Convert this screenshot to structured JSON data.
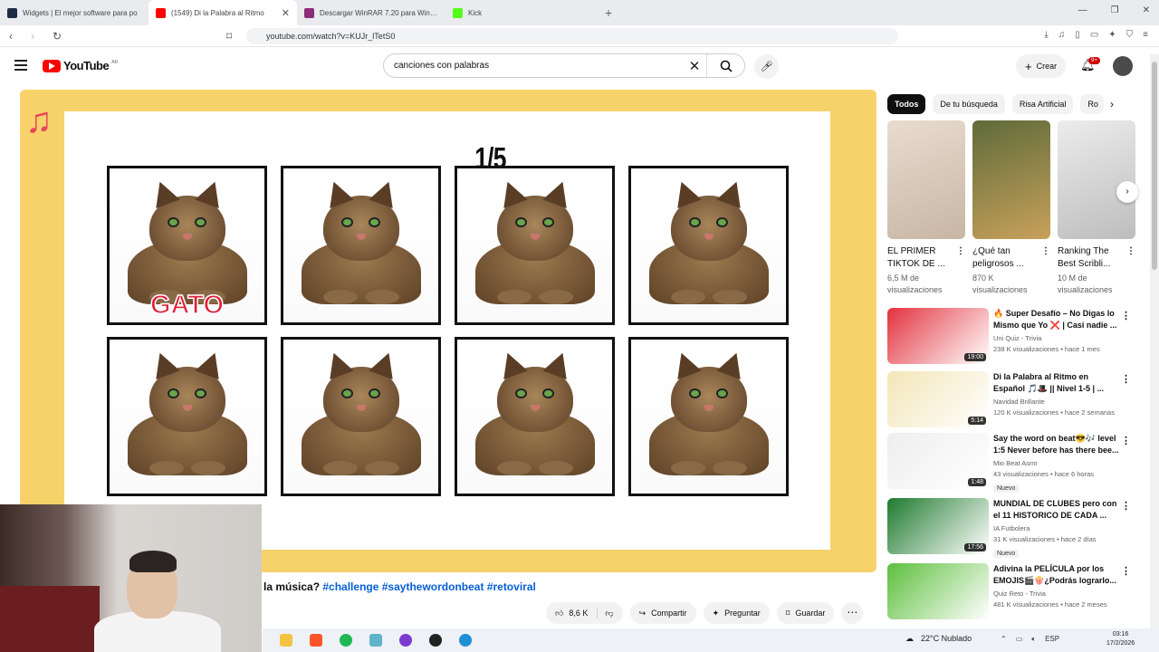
{
  "browser": {
    "tabs": [
      {
        "title": "Widgets | El mejor software para po",
        "color": "#1f2a44",
        "active": false
      },
      {
        "title": "(1549) Di la Palabra al Ritmo",
        "color": "#ff0000",
        "active": true
      },
      {
        "title": "Descargar WinRAR 7.20 para Window",
        "color": "#8b2d7a",
        "active": false
      },
      {
        "title": "Kick",
        "color": "#53fc18",
        "active": false
      }
    ],
    "new_tab": "+",
    "url": "youtube.com/watch?v=KUJr_lTetS0"
  },
  "youtube": {
    "logo_text": "YouTube",
    "region": "AR",
    "search_value": "canciones con palabras",
    "create_label": "Crear",
    "notif_count": "9+"
  },
  "video": {
    "counter": "1/5",
    "word": "GATO",
    "caption_prefix": "la música? ",
    "hashtags": [
      "#challenge",
      "#saythewordonbeat",
      "#retoviral"
    ],
    "likes": "8,6 K",
    "share_label": "Compartir",
    "ask_label": "Preguntar",
    "save_label": "Guardar"
  },
  "chips": [
    "Todos",
    "De tu búsqueda",
    "Risa Artificial",
    "Ro"
  ],
  "shorts": [
    {
      "title": "EL PRIMER TIKTOK DE ...",
      "views": "6,5 M de visualizaciones",
      "color1": "#e8dccf",
      "color2": "#c7b6a4"
    },
    {
      "title": "¿Qué tan peligrosos ...",
      "views": "870 K visualizaciones",
      "color1": "#5e6b3a",
      "color2": "#c8a15a"
    },
    {
      "title": "Ranking The Best Scribli...",
      "views": "10 M de visualizaciones",
      "color1": "#ececec",
      "color2": "#bdbdbd"
    }
  ],
  "recommendations": [
    {
      "title": "🔥 Super Desafío – No Digas lo Mismo que Yo ❌ | Casi nadie ...",
      "channel": "Uni Quiz - Trivia",
      "meta": "238 K visualizaciones • hace 1 mes",
      "duration": "19:00",
      "new": "",
      "color": "#e3323e"
    },
    {
      "title": "Di la Palabra al Ritmo en Español 🎵🎩 || Nivel 1-5 | ...",
      "channel": "Navidad Brillante",
      "meta": "120 K visualizaciones • hace 2 semanas",
      "duration": "5:14",
      "new": "",
      "color": "#f3e6b8"
    },
    {
      "title": "Say the word on beat😎🎶 level 1:5 Never before has there bee...",
      "channel": "Mio Beat Asmr",
      "meta": "43 visualizaciones • hace 6 horas",
      "duration": "1:48",
      "new": "Nuevo",
      "color": "#eeeeee"
    },
    {
      "title": "MUNDIAL DE CLUBES pero con el 11 HISTORICO DE CADA ...",
      "channel": "IA Futbolera",
      "meta": "31 K visualizaciones • hace 2 días",
      "duration": "17:56",
      "new": "Nuevo",
      "color": "#1f7a2e"
    },
    {
      "title": "Adivina la PELÍCULA por los EMOJIS🎬🍿¿Podrás lograrlo...",
      "channel": "Quiz Reto - Trivia",
      "meta": "481 K visualizaciones • hace 2 meses",
      "duration": "",
      "new": "",
      "color": "#5cbf3c"
    }
  ],
  "taskbar": {
    "weather": "22°C  Nublado",
    "lang": "ESP",
    "time": "03:16",
    "date": "17/2/2026"
  }
}
